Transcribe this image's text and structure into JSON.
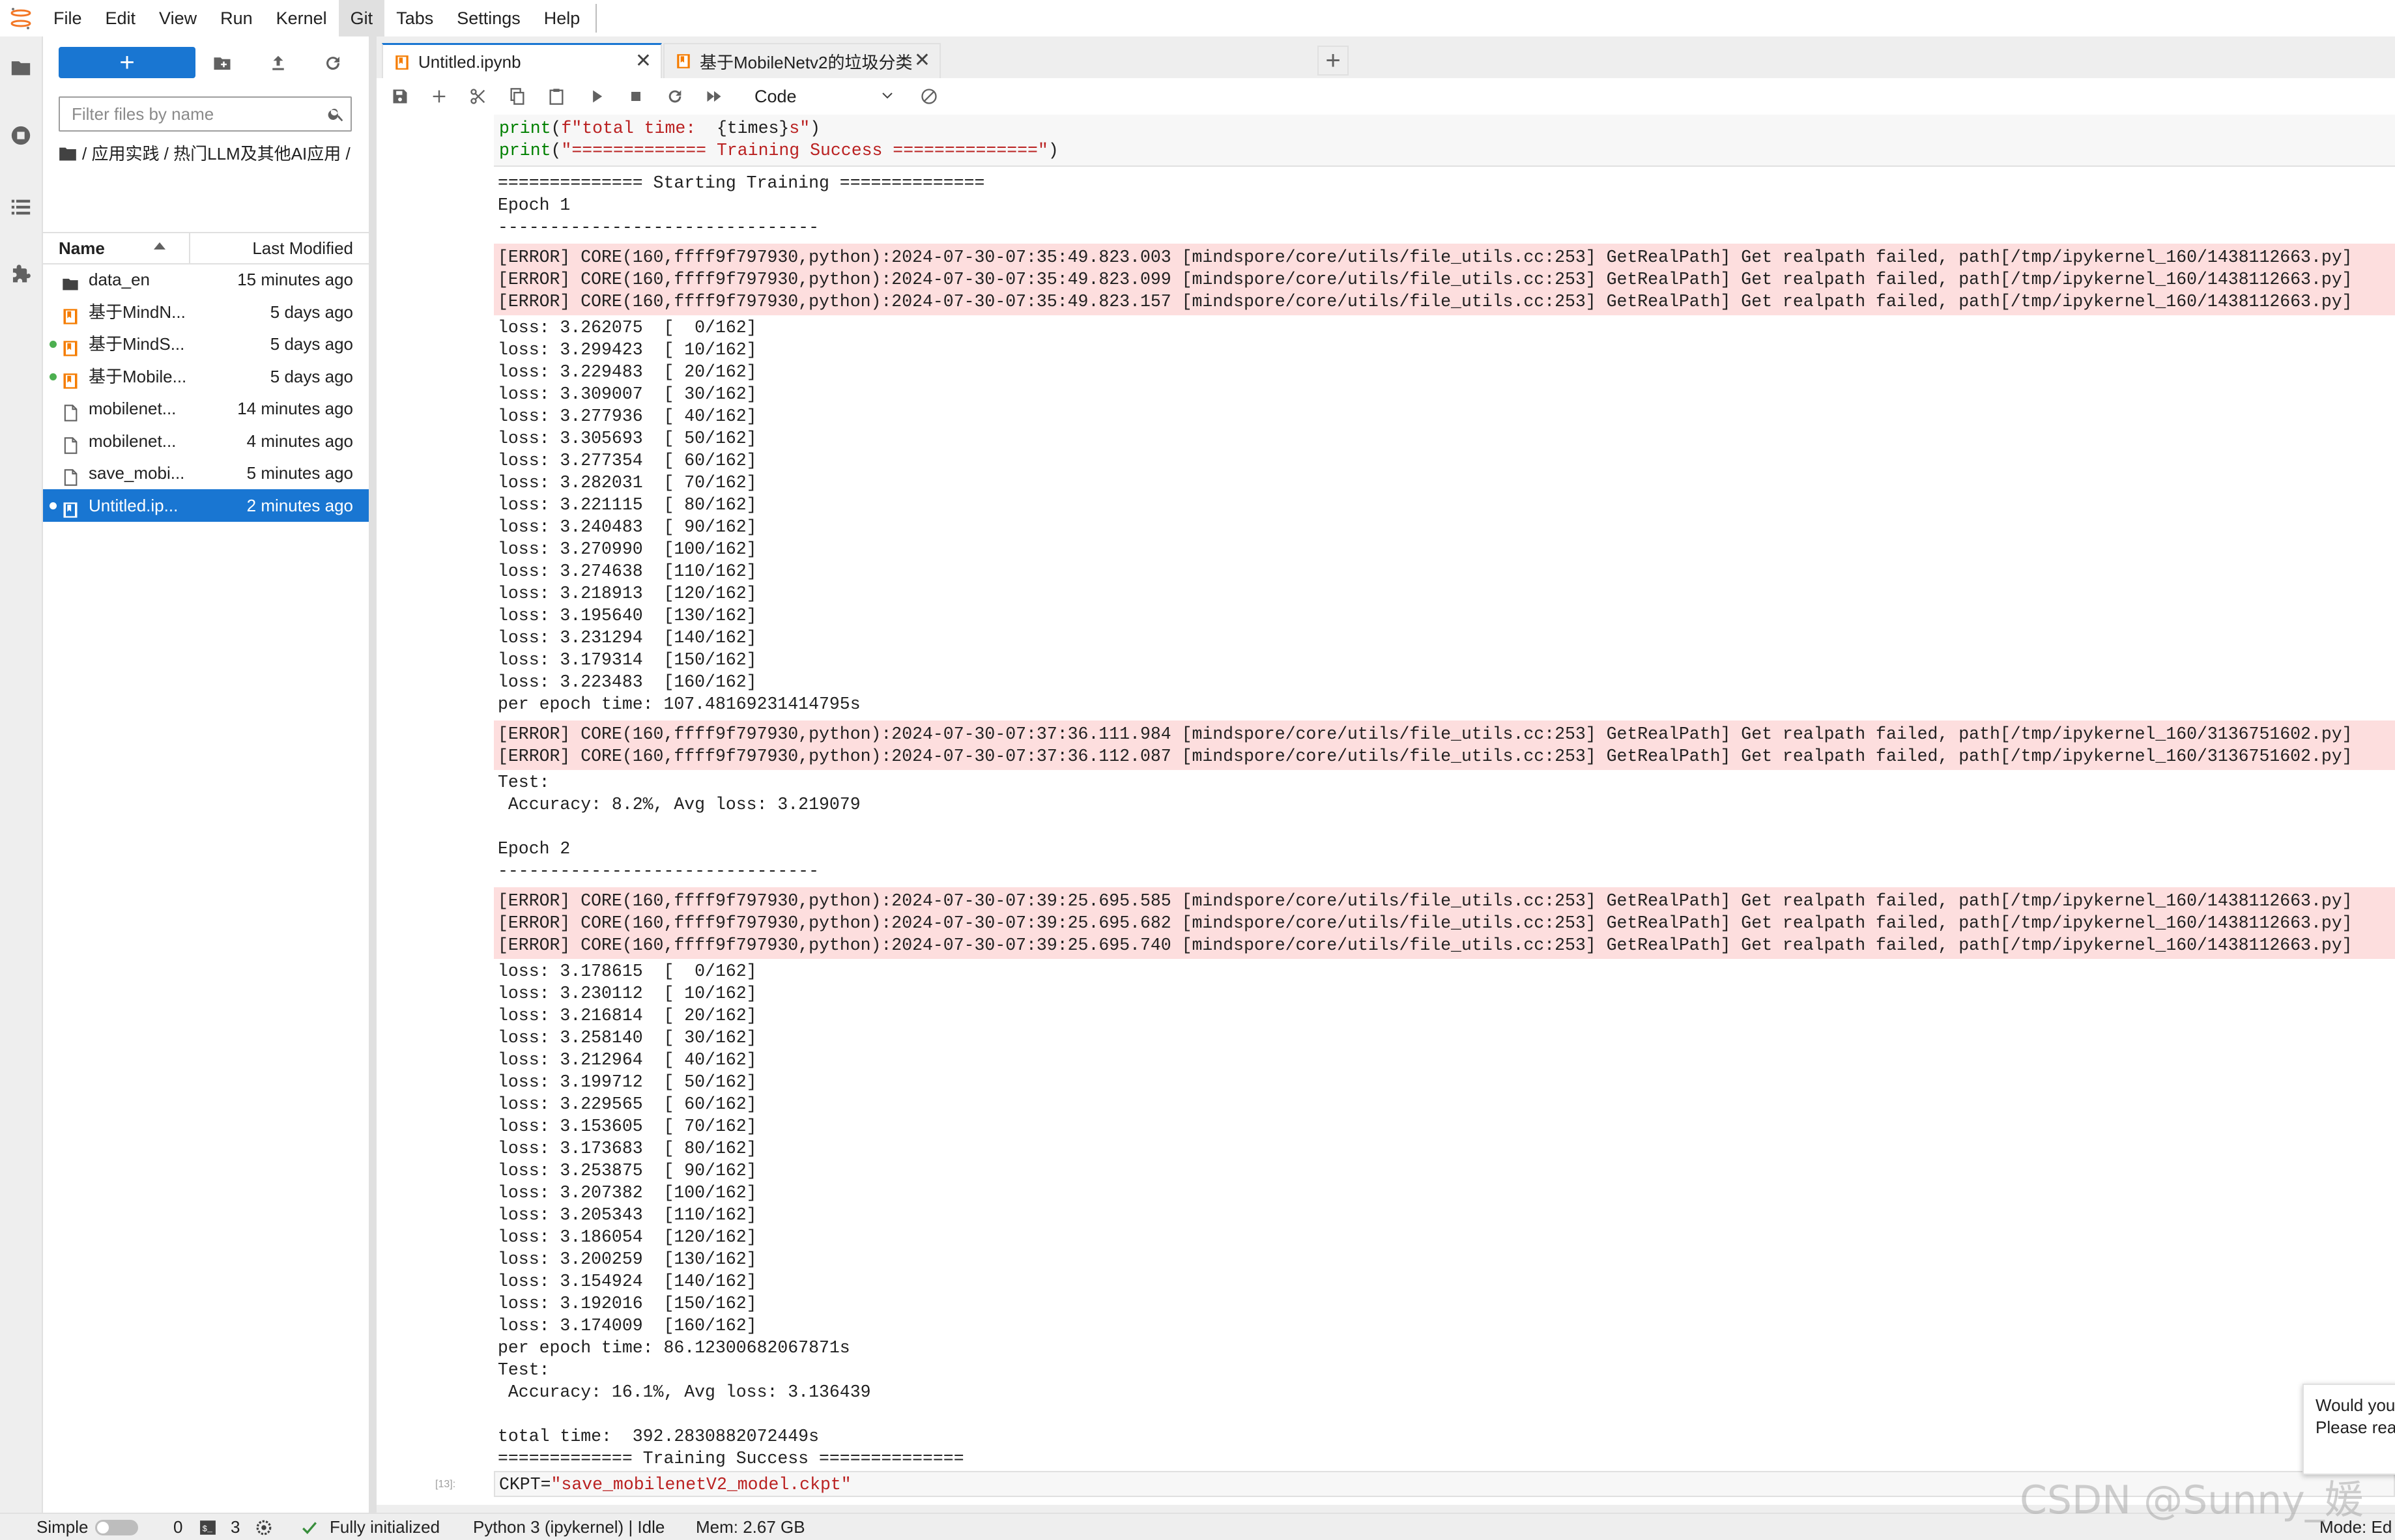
{
  "menu": [
    "File",
    "Edit",
    "View",
    "Run",
    "Kernel",
    "Git",
    "Tabs",
    "Settings",
    "Help"
  ],
  "file_browser": {
    "new_label": "+",
    "filter_placeholder": "Filter files by name",
    "breadcrumb": "/ 应用实践 / 热门LLM及其他AI应用 /",
    "col_name": "Name",
    "col_modified": "Last Modified",
    "files": [
      {
        "name": "data_en",
        "modified": "15 minutes ago",
        "type": "folder",
        "running": false,
        "selected": false
      },
      {
        "name": "基于MindN...",
        "modified": "5 days ago",
        "type": "notebook",
        "running": false,
        "selected": false
      },
      {
        "name": "基于MindS...",
        "modified": "5 days ago",
        "type": "notebook",
        "running": true,
        "selected": false
      },
      {
        "name": "基于Mobile...",
        "modified": "5 days ago",
        "type": "notebook",
        "running": true,
        "selected": false
      },
      {
        "name": "mobilenet...",
        "modified": "14 minutes ago",
        "type": "file",
        "running": false,
        "selected": false
      },
      {
        "name": "mobilenet...",
        "modified": "4 minutes ago",
        "type": "file",
        "running": false,
        "selected": false
      },
      {
        "name": "save_mobi...",
        "modified": "5 minutes ago",
        "type": "file",
        "running": false,
        "selected": false
      },
      {
        "name": "Untitled.ip...",
        "modified": "2 minutes ago",
        "type": "notebook",
        "running": true,
        "selected": true
      }
    ]
  },
  "tabs": [
    {
      "label": "Untitled.ipynb",
      "active": true
    },
    {
      "label": "基于MobileNetv2的垃圾分类",
      "active": false
    }
  ],
  "toolbar": {
    "cell_type": "Code"
  },
  "code_top": [
    [
      {
        "c": "kw",
        "t": "print"
      },
      {
        "c": "nm",
        "t": "("
      },
      {
        "c": "str",
        "t": "f\"total time:  "
      },
      {
        "c": "nm",
        "t": "{times}"
      },
      {
        "c": "str",
        "t": "s\""
      },
      {
        "c": "nm",
        "t": ")"
      }
    ],
    [
      {
        "c": "kw",
        "t": "print"
      },
      {
        "c": "nm",
        "t": "("
      },
      {
        "c": "str",
        "t": "\"============= Training Success ==============\""
      },
      {
        "c": "nm",
        "t": ")"
      }
    ]
  ],
  "output": [
    {
      "kind": "text",
      "lines": [
        "============== Starting Training ==============",
        "Epoch 1",
        "-------------------------------"
      ]
    },
    {
      "kind": "error",
      "lines": [
        "[ERROR] CORE(160,ffff9f797930,python):2024-07-30-07:35:49.823.003 [mindspore/core/utils/file_utils.cc:253] GetRealPath] Get realpath failed, path[/tmp/ipykernel_160/1438112663.py]",
        "[ERROR] CORE(160,ffff9f797930,python):2024-07-30-07:35:49.823.099 [mindspore/core/utils/file_utils.cc:253] GetRealPath] Get realpath failed, path[/tmp/ipykernel_160/1438112663.py]",
        "[ERROR] CORE(160,ffff9f797930,python):2024-07-30-07:35:49.823.157 [mindspore/core/utils/file_utils.cc:253] GetRealPath] Get realpath failed, path[/tmp/ipykernel_160/1438112663.py]"
      ]
    },
    {
      "kind": "text",
      "lines": [
        "loss: 3.262075  [  0/162]",
        "loss: 3.299423  [ 10/162]",
        "loss: 3.229483  [ 20/162]",
        "loss: 3.309007  [ 30/162]",
        "loss: 3.277936  [ 40/162]",
        "loss: 3.305693  [ 50/162]",
        "loss: 3.277354  [ 60/162]",
        "loss: 3.282031  [ 70/162]",
        "loss: 3.221115  [ 80/162]",
        "loss: 3.240483  [ 90/162]",
        "loss: 3.270990  [100/162]",
        "loss: 3.274638  [110/162]",
        "loss: 3.218913  [120/162]",
        "loss: 3.195640  [130/162]",
        "loss: 3.231294  [140/162]",
        "loss: 3.179314  [150/162]",
        "loss: 3.223483  [160/162]",
        "per epoch time: 107.48169231414795s"
      ]
    },
    {
      "kind": "error",
      "lines": [
        "[ERROR] CORE(160,ffff9f797930,python):2024-07-30-07:37:36.111.984 [mindspore/core/utils/file_utils.cc:253] GetRealPath] Get realpath failed, path[/tmp/ipykernel_160/3136751602.py]",
        "[ERROR] CORE(160,ffff9f797930,python):2024-07-30-07:37:36.112.087 [mindspore/core/utils/file_utils.cc:253] GetRealPath] Get realpath failed, path[/tmp/ipykernel_160/3136751602.py]"
      ]
    },
    {
      "kind": "text",
      "lines": [
        "Test:",
        " Accuracy: 8.2%, Avg loss: 3.219079",
        "",
        "Epoch 2",
        "-------------------------------"
      ]
    },
    {
      "kind": "error",
      "lines": [
        "[ERROR] CORE(160,ffff9f797930,python):2024-07-30-07:39:25.695.585 [mindspore/core/utils/file_utils.cc:253] GetRealPath] Get realpath failed, path[/tmp/ipykernel_160/1438112663.py]",
        "[ERROR] CORE(160,ffff9f797930,python):2024-07-30-07:39:25.695.682 [mindspore/core/utils/file_utils.cc:253] GetRealPath] Get realpath failed, path[/tmp/ipykernel_160/1438112663.py]",
        "[ERROR] CORE(160,ffff9f797930,python):2024-07-30-07:39:25.695.740 [mindspore/core/utils/file_utils.cc:253] GetRealPath] Get realpath failed, path[/tmp/ipykernel_160/1438112663.py]"
      ]
    },
    {
      "kind": "text",
      "lines": [
        "loss: 3.178615  [  0/162]",
        "loss: 3.230112  [ 10/162]",
        "loss: 3.216814  [ 20/162]",
        "loss: 3.258140  [ 30/162]",
        "loss: 3.212964  [ 40/162]",
        "loss: 3.199712  [ 50/162]",
        "loss: 3.229565  [ 60/162]",
        "loss: 3.153605  [ 70/162]",
        "loss: 3.173683  [ 80/162]",
        "loss: 3.253875  [ 90/162]",
        "loss: 3.207382  [100/162]",
        "loss: 3.205343  [110/162]",
        "loss: 3.186054  [120/162]",
        "loss: 3.200259  [130/162]",
        "loss: 3.154924  [140/162]",
        "loss: 3.192016  [150/162]",
        "loss: 3.174009  [160/162]",
        "per epoch time: 86.12300682067871s",
        "Test:",
        " Accuracy: 16.1%, Avg loss: 3.136439",
        "",
        "total time:  392.2830882072449s",
        "============= Training Success =============="
      ]
    }
  ],
  "next_cell": {
    "prompt": "[13]:",
    "code": [
      {
        "c": "nm",
        "t": "CKPT="
      },
      {
        "c": "str",
        "t": "\"save_mobilenetV2_model.ckpt\""
      }
    ]
  },
  "status": {
    "mode_simple": "Simple",
    "terminals": "0",
    "kernels": "3",
    "init": "Fully initialized",
    "kernel": "Python 3 (ipykernel) | Idle",
    "mem": "Mem: 2.67 GB",
    "mode": "Mode: Ed"
  },
  "toast": {
    "line1": "Would you",
    "line2": "Please rea"
  },
  "watermark": "CSDN @Sunny_媛",
  "colors": {
    "accent": "#1976d2",
    "error_bg": "#fddede",
    "keyword": "#008000",
    "string": "#ba2121"
  }
}
